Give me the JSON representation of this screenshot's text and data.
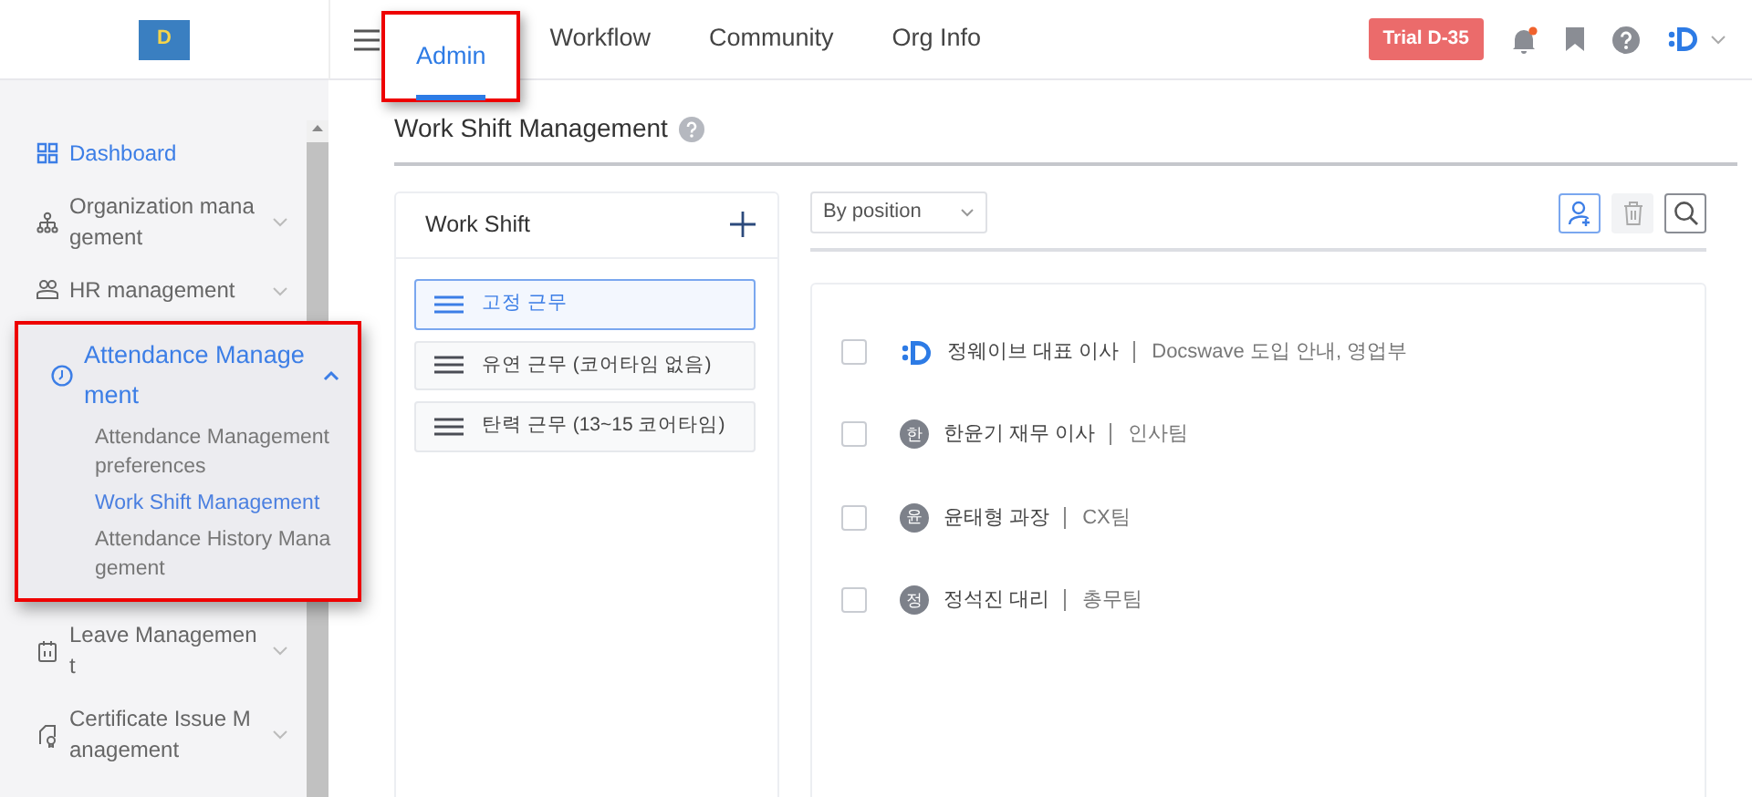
{
  "header": {
    "logo": "D",
    "tabs": [
      {
        "label": "Admin",
        "selected": true,
        "highlighted": true
      },
      {
        "label": "Workflow",
        "selected": false,
        "highlighted": false
      },
      {
        "label": "Community",
        "selected": false,
        "highlighted": false
      },
      {
        "label": "Org Info",
        "selected": false,
        "highlighted": false
      }
    ],
    "trial_badge": "Trial D-35",
    "has_new_notifications": true
  },
  "sidebar": {
    "items": [
      {
        "kind": "link",
        "label": "Dashboard",
        "selected": true
      },
      {
        "kind": "group",
        "label": "Organization management",
        "selected": false,
        "expanded": false
      },
      {
        "kind": "group",
        "label": "HR management",
        "selected": false,
        "expanded": false
      },
      {
        "kind": "group",
        "label": "Attendance Management",
        "selected": true,
        "expanded": true,
        "highlighted": true,
        "children": [
          {
            "label": "Attendance Management preferences",
            "selected": false
          },
          {
            "label": "Work Shift Management",
            "selected": true
          },
          {
            "label": "Attendance History Management",
            "selected": false
          }
        ]
      },
      {
        "kind": "group",
        "label": "Leave Management",
        "selected": false,
        "expanded": false
      },
      {
        "kind": "group",
        "label": "Certificate Issue Management",
        "selected": false,
        "expanded": false
      }
    ]
  },
  "page": {
    "title": "Work Shift Management",
    "work_shift_panel": {
      "title": "Work Shift",
      "shifts": [
        {
          "label": "고정 근무",
          "selected": true
        },
        {
          "label": "유연 근무 (코어타임 없음)",
          "selected": false
        },
        {
          "label": "탄력 근무 (13~15 코어타임)",
          "selected": false
        }
      ]
    },
    "filter": {
      "value": "By position"
    },
    "members": [
      {
        "kind": "logo",
        "name": "정웨이브 대표 이사",
        "team": "Docswave 도입 안내, 영업부",
        "checked": false
      },
      {
        "kind": "initial",
        "initial": "한",
        "name": "한윤기 재무 이사",
        "team": "인사팀",
        "checked": false
      },
      {
        "kind": "initial",
        "initial": "윤",
        "name": "윤태형 과장",
        "team": "CX팀",
        "checked": false
      },
      {
        "kind": "initial",
        "initial": "정",
        "name": "정석진 대리",
        "team": "총무팀",
        "checked": false
      }
    ]
  }
}
